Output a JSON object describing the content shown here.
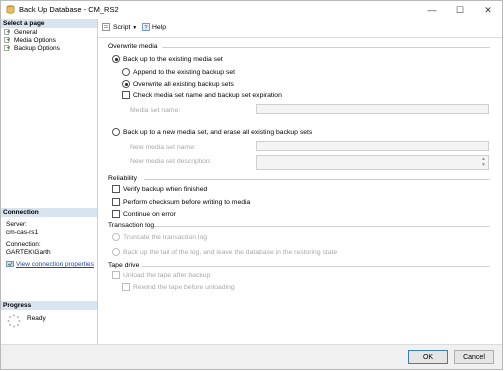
{
  "window": {
    "title": "Back Up Database - CM_RS2",
    "minimize_glyph": "—",
    "maximize_glyph": "☐",
    "close_glyph": "✕"
  },
  "left_pane": {
    "select_page_header": "Select a page",
    "pages": [
      {
        "label": "General",
        "icon": "page-icon"
      },
      {
        "label": "Media Options",
        "icon": "page-icon"
      },
      {
        "label": "Backup Options",
        "icon": "page-icon"
      }
    ],
    "connection_header": "Connection",
    "server_label": "Server:",
    "server_value": "cm-cas-rs1",
    "connection_label": "Connection:",
    "connection_value": "GARTEK\\Garth",
    "view_connection_link": "View connection properties",
    "progress_header": "Progress",
    "progress_status": "Ready"
  },
  "toolbar": {
    "script_label": "Script",
    "help_label": "Help"
  },
  "overwrite_media": {
    "section_title": "Overwrite media",
    "backup_existing_label": "Back up to the existing media set",
    "append_label": "Append to the existing backup set",
    "overwrite_all_label": "Overwrite all existing backup sets",
    "check_name_label": "Check media set name and backup set expiration",
    "media_set_name_label": "Media set name:",
    "backup_new_label": "Back up to a new media set, and erase all existing backup sets",
    "new_media_set_name_label": "New media set name:",
    "new_media_set_desc_label": "New media set description:"
  },
  "reliability": {
    "section_title": "Reliability",
    "verify_label": "Verify backup when finished",
    "checksum_label": "Perform checksum before writing to media",
    "continue_label": "Continue on error"
  },
  "transaction_log": {
    "section_title": "Transaction log",
    "truncate_label": "Truncate the transaction log",
    "tail_label": "Back up the tail of the log, and leave the database in the restoring state"
  },
  "tape_drive": {
    "section_title": "Tape drive",
    "unload_label": "Unload the tape after backup",
    "rewind_label": "Rewind the tape before unloading"
  },
  "buttons": {
    "ok_label": "OK",
    "cancel_label": "Cancel"
  }
}
